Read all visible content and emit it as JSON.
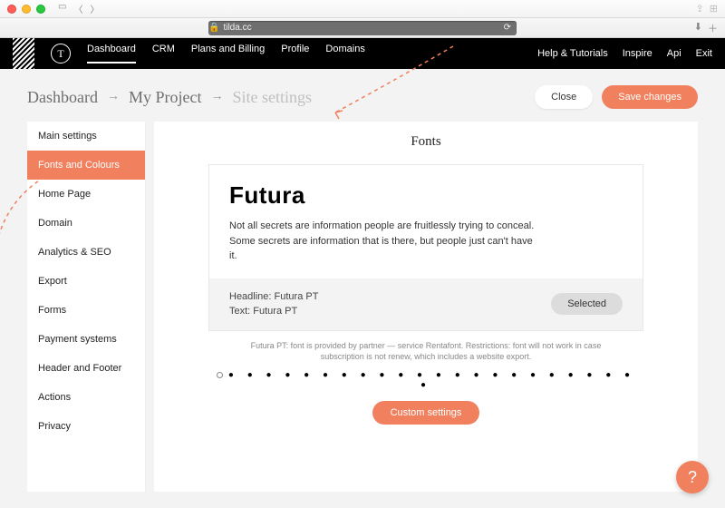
{
  "browser": {
    "url_host": "tilda.cc"
  },
  "topnav": {
    "links": [
      "Dashboard",
      "CRM",
      "Plans and Billing",
      "Profile",
      "Domains"
    ],
    "right": [
      "Help & Tutorials",
      "Inspire",
      "Api",
      "Exit"
    ]
  },
  "breadcrumb": {
    "items": [
      "Dashboard",
      "My Project",
      "Site settings"
    ],
    "close_label": "Close",
    "save_label": "Save changes"
  },
  "sidebar": {
    "items": [
      "Main settings",
      "Fonts and Colours",
      "Home Page",
      "Domain",
      "Analytics & SEO",
      "Export",
      "Forms",
      "Payment systems",
      "Header and Footer",
      "Actions",
      "Privacy"
    ],
    "active_index": 1
  },
  "panel": {
    "heading": "Fonts",
    "font_name": "Futura",
    "font_desc": "Not all secrets are information people are fruitlessly trying to conceal. Some secrets are information that is there, but people just can't have it.",
    "headline_label": "Headline: Futura PT",
    "text_label": "Text: Futura PT",
    "selected_label": "Selected",
    "footnote": "Futura PT: font is provided by partner — service Rentafont. Restrictions: font will not work in case subscription is not renew, which includes a website export.",
    "custom_label": "Custom settings"
  },
  "help": {
    "label": "?"
  },
  "colors": {
    "accent": "#f1805f"
  }
}
